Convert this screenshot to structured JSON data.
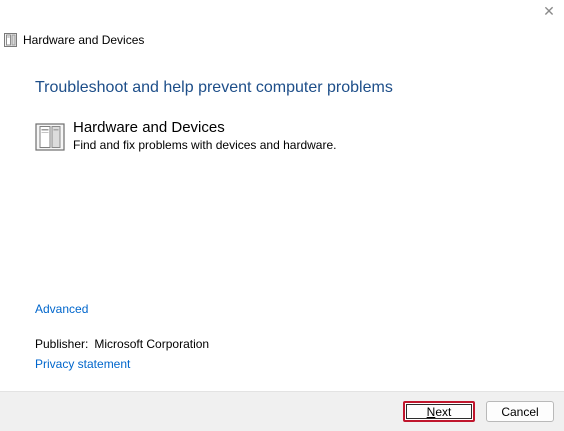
{
  "window": {
    "title": "Hardware and Devices",
    "close_glyph": "✕"
  },
  "main": {
    "heading": "Troubleshoot and help prevent computer problems",
    "tool": {
      "name": "Hardware and Devices",
      "description": "Find and fix problems with devices and hardware.",
      "icon": "hardware-device-icon"
    },
    "advanced_link": "Advanced",
    "publisher_label": "Publisher:",
    "publisher_value": "Microsoft Corporation",
    "privacy_link": "Privacy statement"
  },
  "footer": {
    "next_label": {
      "mnemonic": "N",
      "rest": "ext"
    },
    "cancel_label": "Cancel"
  },
  "colors": {
    "heading": "#1d4e89",
    "link": "#0066cc",
    "highlight": "#c0162d"
  }
}
